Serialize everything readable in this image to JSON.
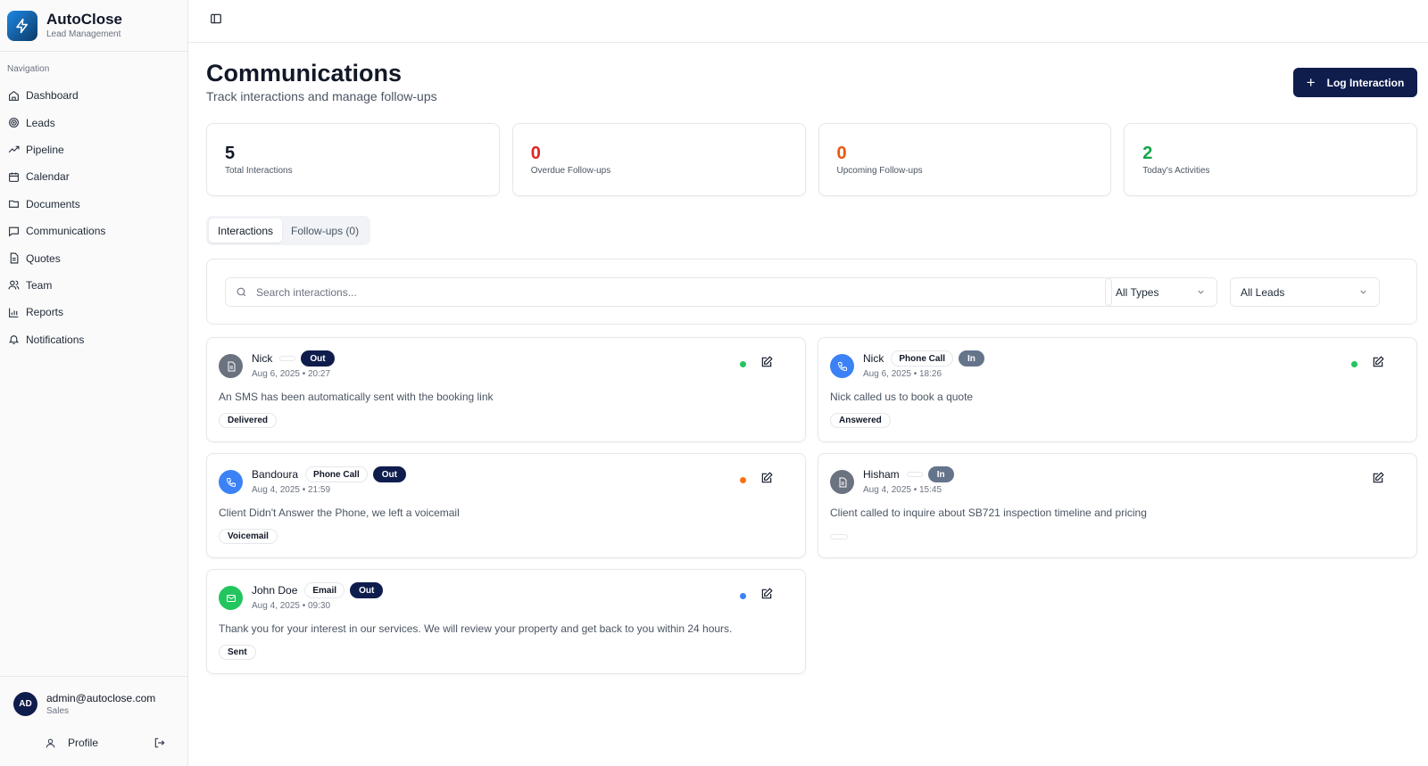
{
  "app": {
    "name": "AutoClose",
    "subtitle": "Lead Management"
  },
  "sidebar": {
    "section_label": "Navigation",
    "items": [
      {
        "label": "Dashboard",
        "icon": "home-icon"
      },
      {
        "label": "Leads",
        "icon": "target-icon"
      },
      {
        "label": "Pipeline",
        "icon": "trending-up-icon"
      },
      {
        "label": "Calendar",
        "icon": "calendar-icon"
      },
      {
        "label": "Documents",
        "icon": "folder-icon"
      },
      {
        "label": "Communications",
        "icon": "message-square-icon"
      },
      {
        "label": "Quotes",
        "icon": "file-text-icon"
      },
      {
        "label": "Team",
        "icon": "users-icon"
      },
      {
        "label": "Reports",
        "icon": "bar-chart-icon"
      },
      {
        "label": "Notifications",
        "icon": "bell-icon"
      }
    ],
    "user": {
      "initials": "AD",
      "email": "admin@autoclose.com",
      "role": "Sales",
      "profile_label": "Profile"
    }
  },
  "header": {
    "title": "Communications",
    "subtitle": "Track interactions and manage follow-ups",
    "action_label": "Log Interaction"
  },
  "stats": [
    {
      "value": "5",
      "label": "Total Interactions",
      "color": "#111827"
    },
    {
      "value": "0",
      "label": "Overdue Follow-ups",
      "color": "#dc2626"
    },
    {
      "value": "0",
      "label": "Upcoming Follow-ups",
      "color": "#ea580c"
    },
    {
      "value": "2",
      "label": "Today's Activities",
      "color": "#16a34a"
    }
  ],
  "tabs": [
    {
      "label": "Interactions",
      "active": true
    },
    {
      "label": "Follow-ups (0)",
      "active": false
    }
  ],
  "filters": {
    "search_placeholder": "Search interactions...",
    "type_select": "All Types",
    "lead_select": "All Leads"
  },
  "interactions": [
    {
      "name": "Nick",
      "type": "",
      "direction": "Out",
      "date": "Aug 6, 2025 • 20:27",
      "body": "An SMS has been automatically sent with the booking link",
      "status": "Delivered",
      "icon": "file-icon",
      "icon_color": "#6b7280",
      "dot_color": "#22c55e",
      "dir_color": "#0f1d4d"
    },
    {
      "name": "Nick",
      "type": "Phone Call",
      "direction": "In",
      "date": "Aug 6, 2025 • 18:26",
      "body": "Nick called us to book a quote",
      "status": "Answered",
      "icon": "phone-icon",
      "icon_color": "#3b82f6",
      "dot_color": "#22c55e",
      "dir_color": "#64748b"
    },
    {
      "name": "Bandoura",
      "type": "Phone Call",
      "direction": "Out",
      "date": "Aug 4, 2025 • 21:59",
      "body": "Client Didn't Answer the Phone, we left a voicemail",
      "status": "Voicemail",
      "icon": "phone-icon",
      "icon_color": "#3b82f6",
      "dot_color": "#f97316",
      "dir_color": "#0f1d4d"
    },
    {
      "name": "Hisham",
      "type": "",
      "direction": "In",
      "date": "Aug 4, 2025 • 15:45",
      "body": "Client called to inquire about SB721 inspection timeline and pricing",
      "status": "",
      "icon": "file-icon",
      "icon_color": "#6b7280",
      "dot_color": "",
      "dir_color": "#64748b"
    },
    {
      "name": "John Doe",
      "type": "Email",
      "direction": "Out",
      "date": "Aug 4, 2025 • 09:30",
      "body": "Thank you for your interest in our services. We will review your property and get back to you within 24 hours.",
      "status": "Sent",
      "icon": "mail-icon",
      "icon_color": "#22c55e",
      "dot_color": "#3b82f6",
      "dir_color": "#0f1d4d"
    }
  ]
}
